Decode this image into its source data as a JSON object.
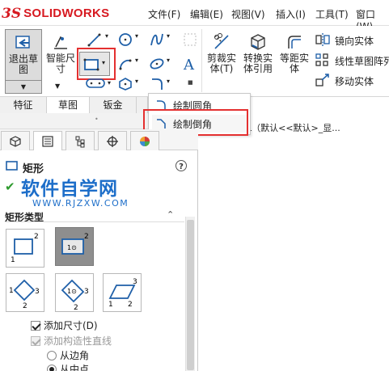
{
  "app": {
    "logo_prefix": "3S",
    "logo_text": "SOLIDWORKS"
  },
  "menu": {
    "file": "文件(F)",
    "edit": "编辑(E)",
    "view": "视图(V)",
    "insert": "插入(I)",
    "tools": "工具(T)",
    "window": "窗口(W)"
  },
  "ribbon": {
    "exit_sketch_line1": "退出草",
    "exit_sketch_line2": "图",
    "smart_dim_line1": "智能尺",
    "smart_dim_line2": "寸",
    "trim_line1": "剪裁实",
    "trim_line2": "体(T)",
    "convert_line1": "转换实",
    "convert_line2": "体引用",
    "offset_line1": "等距实",
    "offset_line2": "体",
    "mirror": "镜向实体",
    "linear_pattern": "线性草图阵列",
    "move": "移动实体"
  },
  "tabs": {
    "feature": "特征",
    "sketch": "草图",
    "sheet_metal": "钣金"
  },
  "dropdown": {
    "fillet": "绘制圆角",
    "chamfer": "绘制倒角"
  },
  "tree": {
    "config_text": "L（默认<<默认>_显..."
  },
  "pm": {
    "title": "矩形",
    "help": "?",
    "watermark_big": "软件自学网",
    "watermark_small": "WWW.RJZXW.COM",
    "section_title": "矩形类型",
    "add_dimensions": "添加尺寸(D)",
    "add_construction": "添加构造性直线",
    "from_corner": "从边角",
    "from_midpoint": "从中点"
  },
  "colors": {
    "logo_red": "#d71920",
    "highlight_red": "#e43030",
    "watermark_blue": "#1d6ec9",
    "active_rect_btn": "#8e8e8e"
  }
}
